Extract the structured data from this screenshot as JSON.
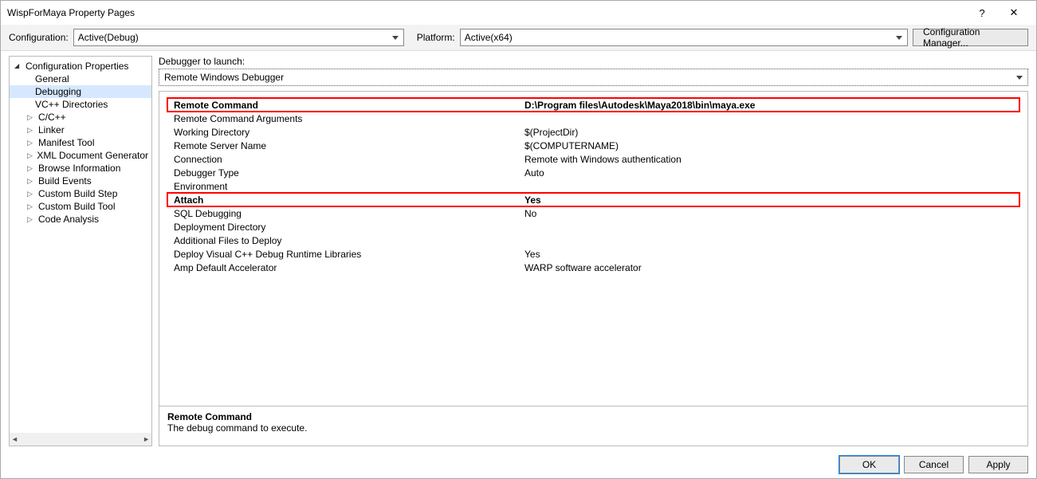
{
  "window": {
    "title": "WispForMaya Property Pages",
    "help": "?",
    "close": "✕"
  },
  "configRow": {
    "configLabel": "Configuration:",
    "configValue": "Active(Debug)",
    "platformLabel": "Platform:",
    "platformValue": "Active(x64)",
    "managerBtn": "Configuration Manager..."
  },
  "tree": {
    "root": "Configuration Properties",
    "items": [
      {
        "label": "General",
        "type": "child"
      },
      {
        "label": "Debugging",
        "type": "child",
        "selected": true
      },
      {
        "label": "VC++ Directories",
        "type": "child"
      },
      {
        "label": "C/C++",
        "type": "exp"
      },
      {
        "label": "Linker",
        "type": "exp"
      },
      {
        "label": "Manifest Tool",
        "type": "exp"
      },
      {
        "label": "XML Document Generator",
        "type": "exp"
      },
      {
        "label": "Browse Information",
        "type": "exp"
      },
      {
        "label": "Build Events",
        "type": "exp"
      },
      {
        "label": "Custom Build Step",
        "type": "exp"
      },
      {
        "label": "Custom Build Tool",
        "type": "exp"
      },
      {
        "label": "Code Analysis",
        "type": "exp"
      }
    ]
  },
  "launcher": {
    "label": "Debugger to launch:",
    "value": "Remote Windows Debugger"
  },
  "properties": [
    {
      "k": "Remote Command",
      "v": "D:\\Program files\\Autodesk\\Maya2018\\bin\\maya.exe",
      "hl": true
    },
    {
      "k": "Remote Command Arguments",
      "v": ""
    },
    {
      "k": "Working Directory",
      "v": "$(ProjectDir)"
    },
    {
      "k": "Remote Server Name",
      "v": "$(COMPUTERNAME)"
    },
    {
      "k": "Connection",
      "v": "Remote with Windows authentication"
    },
    {
      "k": "Debugger Type",
      "v": "Auto"
    },
    {
      "k": "Environment",
      "v": ""
    },
    {
      "k": "Attach",
      "v": "Yes",
      "hl": true
    },
    {
      "k": "SQL Debugging",
      "v": "No"
    },
    {
      "k": "Deployment Directory",
      "v": ""
    },
    {
      "k": "Additional Files to Deploy",
      "v": ""
    },
    {
      "k": "Deploy Visual C++ Debug Runtime Libraries",
      "v": "Yes"
    },
    {
      "k": "Amp Default Accelerator",
      "v": "WARP software accelerator"
    }
  ],
  "description": {
    "title": "Remote Command",
    "text": "The debug command to execute."
  },
  "footer": {
    "ok": "OK",
    "cancel": "Cancel",
    "apply": "Apply"
  }
}
